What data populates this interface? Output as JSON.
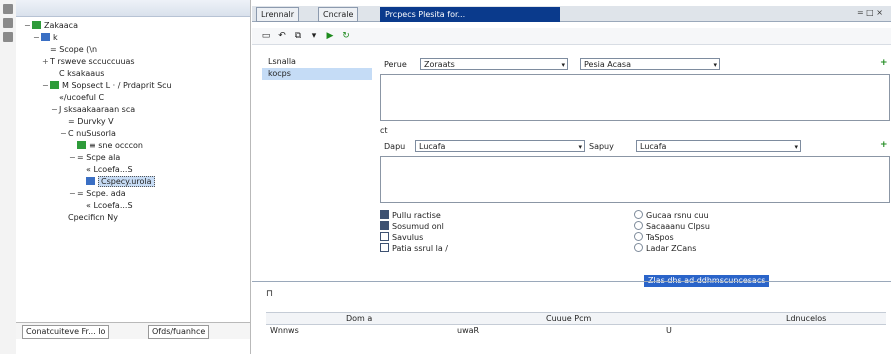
{
  "tree": {
    "header_label": "…",
    "rows": [
      {
        "label": "Zakaaca",
        "indent": 0,
        "icon": "ic-green",
        "expander": "−"
      },
      {
        "label": "k",
        "indent": 1,
        "icon": "ic-blue",
        "expander": "−"
      },
      {
        "label": "= Scope (\\n",
        "indent": 2,
        "icon": "",
        "expander": ""
      },
      {
        "label": "T rsweve sccuccuuas",
        "indent": 2,
        "icon": "",
        "expander": "+"
      },
      {
        "label": "C ksakaaus",
        "indent": 3,
        "icon": "",
        "expander": ""
      },
      {
        "label": "M Sopsect L · / Prdaprit Scu",
        "indent": 2,
        "icon": "ic-green",
        "expander": "−"
      },
      {
        "label": "«/ucoeful C",
        "indent": 3,
        "icon": "",
        "expander": ""
      },
      {
        "label": "J sksaakaaraan sca",
        "indent": 3,
        "icon": "",
        "expander": "−"
      },
      {
        "label": "= Durvky V",
        "indent": 4,
        "icon": "",
        "expander": ""
      },
      {
        "label": "C nuSusorla",
        "indent": 4,
        "icon": "",
        "expander": "−"
      },
      {
        "label": "≡ sne occcon",
        "indent": 5,
        "icon": "ic-green",
        "expander": ""
      },
      {
        "label": "= Scpe ala",
        "indent": 5,
        "icon": "",
        "expander": "−"
      },
      {
        "label": "« Lcoefa...S",
        "indent": 6,
        "icon": "",
        "expander": ""
      },
      {
        "label": "Cspecy.urola",
        "indent": 6,
        "icon": "ic-blue",
        "expander": "",
        "selected": true
      },
      {
        "label": "= Scpe. ada",
        "indent": 5,
        "icon": "",
        "expander": "−"
      },
      {
        "label": "« Lcoefa...S",
        "indent": 6,
        "icon": "",
        "expander": ""
      },
      {
        "label": "Cpecificn Ny",
        "indent": 4,
        "icon": "",
        "expander": ""
      }
    ]
  },
  "left_tabs": [
    {
      "label": "Conatcuiteve Fr... lo"
    },
    {
      "label": "Ofds/fuanhce"
    }
  ],
  "editor_tabs": [
    {
      "label": "Lrennalr"
    },
    {
      "label": "Cncrale"
    },
    {
      "label": "Prcpecs Plesita for..."
    }
  ],
  "window_controls": "= □ ×",
  "toolbar_icons": [
    {
      "name": "save-icon",
      "glyph": "▭"
    },
    {
      "name": "undo-icon",
      "glyph": "↶"
    },
    {
      "name": "copy-icon",
      "glyph": "⧉"
    },
    {
      "name": "dropdown-icon",
      "glyph": "▾"
    },
    {
      "name": "run-icon",
      "glyph": "▶"
    },
    {
      "name": "refresh-icon",
      "glyph": "↻"
    }
  ],
  "nav": {
    "items": [
      {
        "label": "Lsnalla"
      },
      {
        "label": "kocps"
      }
    ]
  },
  "form": {
    "row1_label": "Perue",
    "row1_combo1": "Zoraats",
    "row1_combo2": "Pesia Acasa",
    "row2_header": "ct",
    "row2_label": "Dapu",
    "row2_combo1": "Lucafa",
    "row2_label2": "Sapuy",
    "row2_combo2": "Lucafa",
    "checkboxes": [
      {
        "label": "Pullu ractise",
        "checked": true
      },
      {
        "label": "Sosumud onl",
        "checked": true
      },
      {
        "label": "Savulus",
        "checked": false
      },
      {
        "label": "Patia ssrul la /",
        "checked": false
      }
    ],
    "radios": [
      {
        "label": "Gucaa rsnu cuu"
      },
      {
        "label": "Sacaaanu Clpsu"
      },
      {
        "label": "TaSpos"
      },
      {
        "label": "Ladar ZCans"
      }
    ],
    "link": "Zlas dhs ad ddhmscuncesacs"
  },
  "bottom": {
    "columns": [
      "Dom a",
      "Cuuue Pcm",
      "Ldnucelos"
    ],
    "row": [
      "Wnnws",
      "uwaR",
      "U"
    ]
  }
}
